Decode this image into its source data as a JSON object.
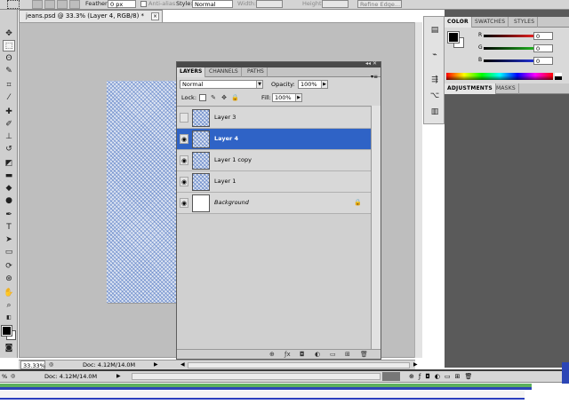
{
  "options_bar": {
    "feather_label": "Feather:",
    "feather_value": "0 px",
    "antialias_label": "Anti-alias",
    "style_label": "Style:",
    "style_value": "Normal",
    "width_label": "Width:",
    "height_label": "Height:",
    "refine_edge_label": "Refine Edge..."
  },
  "document": {
    "tab_title": "jeans.psd @ 33.3% (Layer 4, RGB/8) *",
    "close_glyph": "×"
  },
  "status_bar": {
    "zoom": "33.33%",
    "doc_info": "Doc: 4.12M/14.0M"
  },
  "taskbar": {
    "doc_info": "Doc: 4.12M/14.0M",
    "zoom_fragment": "%"
  },
  "color_panel": {
    "tabs": [
      "COLOR",
      "SWATCHES",
      "STYLES"
    ],
    "r_label": "R",
    "g_label": "G",
    "b_label": "B",
    "r_value": "0",
    "g_value": "0",
    "b_value": "0",
    "r_color": "#e02020",
    "g_color": "#20b020",
    "b_color": "#2030d0"
  },
  "adjustments_panel": {
    "tabs": [
      "ADJUSTMENTS",
      "MASKS"
    ]
  },
  "layers_panel": {
    "tabs": [
      "LAYERS",
      "CHANNELS",
      "PATHS"
    ],
    "blend_mode": "Normal",
    "opacity_label": "Opacity:",
    "opacity_value": "100%",
    "lock_label": "Lock:",
    "fill_label": "Fill:",
    "fill_value": "100%",
    "selected_color": "#2f63c6",
    "layers": [
      {
        "name": "Layer 3",
        "visible": false,
        "selected": false
      },
      {
        "name": "Layer 4",
        "visible": true,
        "selected": true
      },
      {
        "name": "Layer 1 copy",
        "visible": true,
        "selected": false
      },
      {
        "name": "Layer 1",
        "visible": true,
        "selected": false
      },
      {
        "name": "Background",
        "visible": true,
        "selected": false,
        "locked": true
      }
    ],
    "footer_icons": [
      "link-icon",
      "fx-icon",
      "mask-icon",
      "adjustment-icon",
      "group-icon",
      "new-layer-icon",
      "trash-icon"
    ]
  }
}
